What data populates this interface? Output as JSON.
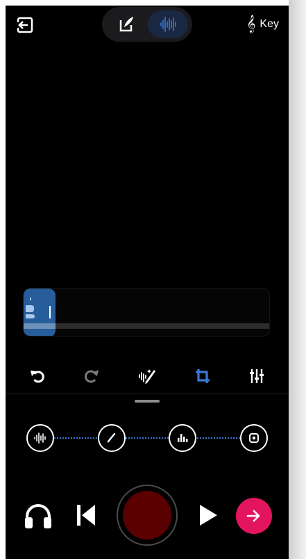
{
  "header": {
    "key_label": "Key",
    "key_symbol": "𝄞"
  },
  "modes": {
    "active": "audio"
  },
  "tools": {
    "items": [
      "undo-icon",
      "redo-icon",
      "magic-edit-icon",
      "crop-icon",
      "mixer-icon"
    ],
    "active": "crop-icon"
  },
  "steps": {
    "items": [
      "waveform-icon",
      "pen-icon",
      "equalizer-icon",
      "master-icon"
    ]
  },
  "controls": {
    "items": [
      "headphones-icon",
      "skip-back-icon",
      "record-button",
      "play-icon",
      "next-arrow-icon"
    ]
  },
  "colors": {
    "background": "#000000",
    "accent_blue": "#3a78d8",
    "clip_blue": "#275d9b",
    "record_red": "#5a0000",
    "next_pink": "#e3155f",
    "icon_white": "#ffffff",
    "icon_gray": "#7a7a7a"
  }
}
